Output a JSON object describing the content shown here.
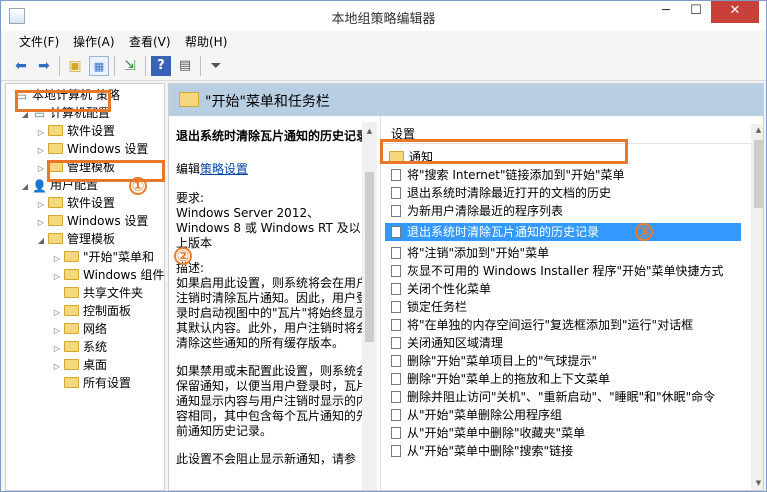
{
  "window": {
    "title": "本地组策略编辑器",
    "min": "─",
    "max": "☐",
    "close": "✕"
  },
  "menus": [
    "文件(F)",
    "操作(A)",
    "查看(V)",
    "帮助(H)"
  ],
  "toolbar_icons": [
    "back-icon",
    "forward-icon",
    "up-folder-icon",
    "show-hide-tree-icon",
    "export-icon",
    "help-icon",
    "properties-icon",
    "filter-icon"
  ],
  "tree": [
    {
      "label": "本地计算机 策略",
      "toggle": "",
      "icon": "computer"
    },
    {
      "label": "计算机配置",
      "toggle": "◢",
      "icon": "computer"
    },
    {
      "label": "软件设置",
      "toggle": "▷",
      "icon": "folder"
    },
    {
      "label": "Windows 设置",
      "toggle": "▷",
      "icon": "folder"
    },
    {
      "label": "管理模板",
      "toggle": "▷",
      "icon": "folder"
    },
    {
      "label": "用户配置",
      "toggle": "◢",
      "icon": "user"
    },
    {
      "label": "软件设置",
      "toggle": "▷",
      "icon": "folder"
    },
    {
      "label": "Windows 设置",
      "toggle": "▷",
      "icon": "folder"
    },
    {
      "label": "管理模板",
      "toggle": "◢",
      "icon": "folder"
    },
    {
      "label": "\"开始\"菜单和",
      "toggle": "▷",
      "icon": "folder"
    },
    {
      "label": "Windows 组件",
      "toggle": "▷",
      "icon": "folder"
    },
    {
      "label": "共享文件夹",
      "toggle": "",
      "icon": "folder"
    },
    {
      "label": "控制面板",
      "toggle": "▷",
      "icon": "folder"
    },
    {
      "label": "网络",
      "toggle": "▷",
      "icon": "folder"
    },
    {
      "label": "系统",
      "toggle": "▷",
      "icon": "folder"
    },
    {
      "label": "桌面",
      "toggle": "▷",
      "icon": "folder"
    },
    {
      "label": "所有设置",
      "toggle": "",
      "icon": "folder"
    }
  ],
  "main": {
    "header_title": "\"开始\"菜单和任务栏",
    "desc": {
      "title": "退出系统时清除瓦片通知的历史记录",
      "edit_prefix": "编辑",
      "edit_link": "策略设置",
      "req_label": "要求:",
      "req_text": "Windows Server 2012、Windows 8 或 Windows RT 及以上版本",
      "desc_label": "描述:",
      "desc_text": "如果启用此设置，则系统将会在用户注销时清除瓦片通知。因此，用户登录时启动视图中的\"瓦片\"将始终显示其默认内容。此外，用户注销时将会清除这些通知的所有缓存版本。",
      "desc_text2": "如果禁用或未配置此设置，则系统会保留通知，以便当用户登录时，瓦片通知显示内容与用户注销时显示的内容相同，其中包含每个瓦片通知的先前通知历史记录。",
      "desc_text3": "此设置不会阻止显示新通知，请参"
    },
    "list_header": "设置",
    "items": [
      {
        "label": "通知",
        "type": "folder"
      },
      {
        "label": "将\"搜索 Internet\"链接添加到\"开始\"菜单",
        "type": "doc"
      },
      {
        "label": "退出系统时清除最近打开的文档的历史",
        "type": "doc"
      },
      {
        "label": "为新用户清除最近的程序列表",
        "type": "doc"
      },
      {
        "label": "退出系统时清除瓦片通知的历史记录",
        "type": "doc",
        "selected": true
      },
      {
        "label": "将\"注销\"添加到\"开始\"菜单",
        "type": "doc"
      },
      {
        "label": "灰显不可用的 Windows Installer 程序\"开始\"菜单快捷方式",
        "type": "doc"
      },
      {
        "label": "关闭个性化菜单",
        "type": "doc"
      },
      {
        "label": "锁定任务栏",
        "type": "doc"
      },
      {
        "label": "将\"在单独的内存空间运行\"复选框添加到\"运行\"对话框",
        "type": "doc"
      },
      {
        "label": "关闭通知区域清理",
        "type": "doc"
      },
      {
        "label": "删除\"开始\"菜单项目上的\"气球提示\"",
        "type": "doc"
      },
      {
        "label": "删除\"开始\"菜单上的拖放和上下文菜单",
        "type": "doc"
      },
      {
        "label": "删除并阻止访问\"关机\"、\"重新启动\"、\"睡眠\"和\"休眠\"命令",
        "type": "doc"
      },
      {
        "label": "从\"开始\"菜单删除公用程序组",
        "type": "doc"
      },
      {
        "label": "从\"开始\"菜单中删除\"收藏夹\"菜单",
        "type": "doc"
      },
      {
        "label": "从\"开始\"菜单中删除\"搜索\"链接",
        "type": "doc"
      }
    ]
  },
  "annotations": [
    "①",
    "②",
    "③"
  ]
}
